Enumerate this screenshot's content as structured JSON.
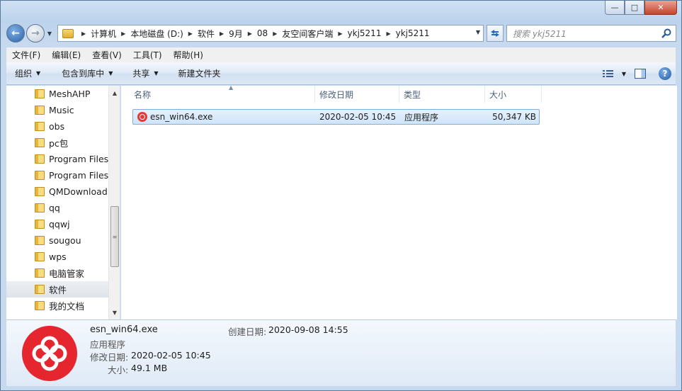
{
  "window": {
    "caption_buttons": {
      "minimize": "—",
      "maximize": "□",
      "close": "✕"
    }
  },
  "nav": {
    "breadcrumbs": [
      "计算机",
      "本地磁盘 (D:)",
      "软件",
      "9月",
      "08",
      "友空间客户端",
      "ykj5211",
      "ykj5211"
    ],
    "search_placeholder": "搜索 ykj5211"
  },
  "menubar": {
    "items": [
      "文件(F)",
      "编辑(E)",
      "查看(V)",
      "工具(T)",
      "帮助(H)"
    ]
  },
  "cmdbar": {
    "organize": "组织",
    "include_in_library": "包含到库中",
    "share": "共享",
    "new_folder": "新建文件夹"
  },
  "navpane": {
    "items": [
      "MeshAHP",
      "Music",
      "obs",
      "pc包",
      "Program Files",
      "Program Files",
      "QMDownload",
      "qq",
      "qqwj",
      "sougou",
      "wps",
      "电脑管家",
      "软件",
      "我的文档"
    ],
    "selected_index": 12
  },
  "columns": {
    "name": "名称",
    "modified": "修改日期",
    "type": "类型",
    "size": "大小"
  },
  "files": [
    {
      "name": "esn_win64.exe",
      "modified": "2020-02-05 10:45",
      "type": "应用程序",
      "size": "50,347 KB"
    }
  ],
  "details": {
    "filename": "esn_win64.exe",
    "type": "应用程序",
    "modified_label": "修改日期:",
    "modified_value": "2020-02-05 10:45",
    "size_label": "大小:",
    "size_value": "49.1 MB",
    "created_label": "创建日期:",
    "created_value": "2020-09-08 14:55"
  },
  "colors": {
    "accent": "#e5262e",
    "selection": "#cfe4fa"
  }
}
